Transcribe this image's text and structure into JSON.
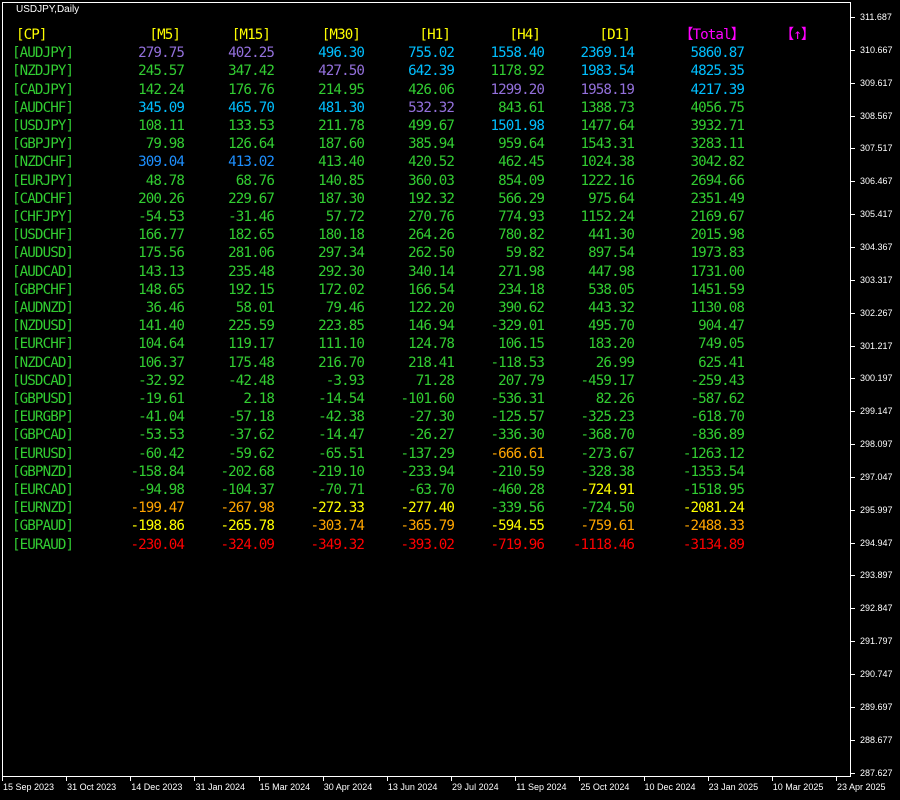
{
  "window": {
    "title": "USDJPY,Daily"
  },
  "colors": {
    "frame": "#ffffff",
    "background": "#000000",
    "axis_text": "#ffffff",
    "header": "#ffff00",
    "header_accent": "#ff00ff",
    "symbol": "#32cd32",
    "purple": "#9370db",
    "blue": "#00bfff",
    "dodger": "#1e90ff",
    "green": "#32cd32",
    "lime": "#7fff00",
    "orange": "#ffa500",
    "yellow": "#ffff00",
    "red": "#ff0000"
  },
  "table": {
    "headers": [
      {
        "label": "[CP]",
        "color": "yellow"
      },
      {
        "label": "[M5]",
        "color": "yellow"
      },
      {
        "label": "[M15]",
        "color": "yellow"
      },
      {
        "label": "[M30]",
        "color": "yellow"
      },
      {
        "label": "[H1]",
        "color": "yellow"
      },
      {
        "label": "[H4]",
        "color": "yellow"
      },
      {
        "label": "[D1]",
        "color": "yellow"
      },
      {
        "label": "【Total】",
        "color": "magenta"
      },
      {
        "label": "【↑】",
        "color": "magenta"
      }
    ],
    "rows": [
      {
        "sym": "[AUDJPY]",
        "v": [
          "279.75",
          "402.25",
          "496.30",
          "755.02",
          "1558.40",
          "2369.14",
          "5860.87"
        ],
        "c": [
          "purple",
          "purple",
          "blue",
          "blue",
          "blue",
          "blue",
          "blue"
        ]
      },
      {
        "sym": "[NZDJPY]",
        "v": [
          "245.57",
          "347.42",
          "427.50",
          "642.39",
          "1178.92",
          "1983.54",
          "4825.35"
        ],
        "c": [
          "green",
          "green",
          "purple",
          "blue",
          "green",
          "blue",
          "blue"
        ]
      },
      {
        "sym": "[CADJPY]",
        "v": [
          "142.24",
          "176.76",
          "214.95",
          "426.06",
          "1299.20",
          "1958.19",
          "4217.39"
        ],
        "c": [
          "green",
          "green",
          "green",
          "green",
          "purple",
          "purple",
          "blue"
        ]
      },
      {
        "sym": "[AUDCHF]",
        "v": [
          "345.09",
          "465.70",
          "481.30",
          "532.32",
          "843.61",
          "1388.73",
          "4056.75"
        ],
        "c": [
          "blue",
          "blue",
          "blue",
          "purple",
          "green",
          "green",
          "green"
        ]
      },
      {
        "sym": "[USDJPY]",
        "v": [
          "108.11",
          "133.53",
          "211.78",
          "499.67",
          "1501.98",
          "1477.64",
          "3932.71"
        ],
        "c": [
          "green",
          "green",
          "green",
          "green",
          "blue",
          "green",
          "green"
        ]
      },
      {
        "sym": "[GBPJPY]",
        "v": [
          "79.98",
          "126.64",
          "187.60",
          "385.94",
          "959.64",
          "1543.31",
          "3283.11"
        ],
        "c": [
          "green",
          "green",
          "green",
          "green",
          "green",
          "green",
          "green"
        ]
      },
      {
        "sym": "[NZDCHF]",
        "v": [
          "309.04",
          "413.02",
          "413.40",
          "420.52",
          "462.45",
          "1024.38",
          "3042.82"
        ],
        "c": [
          "dodger",
          "dodger",
          "green",
          "green",
          "green",
          "green",
          "green"
        ]
      },
      {
        "sym": "[EURJPY]",
        "v": [
          "48.78",
          "68.76",
          "140.85",
          "360.03",
          "854.09",
          "1222.16",
          "2694.66"
        ],
        "c": [
          "green",
          "green",
          "green",
          "green",
          "green",
          "green",
          "green"
        ]
      },
      {
        "sym": "[CADCHF]",
        "v": [
          "200.26",
          "229.67",
          "187.30",
          "192.32",
          "566.29",
          "975.64",
          "2351.49"
        ],
        "c": [
          "green",
          "green",
          "green",
          "green",
          "green",
          "green",
          "green"
        ]
      },
      {
        "sym": "[CHFJPY]",
        "v": [
          "-54.53",
          "-31.46",
          "57.72",
          "270.76",
          "774.93",
          "1152.24",
          "2169.67"
        ],
        "c": [
          "green",
          "green",
          "green",
          "green",
          "green",
          "green",
          "green"
        ]
      },
      {
        "sym": "[USDCHF]",
        "v": [
          "166.77",
          "182.65",
          "180.18",
          "264.26",
          "780.82",
          "441.30",
          "2015.98"
        ],
        "c": [
          "green",
          "green",
          "green",
          "green",
          "green",
          "green",
          "green"
        ]
      },
      {
        "sym": "[AUDUSD]",
        "v": [
          "175.56",
          "281.06",
          "297.34",
          "262.50",
          "59.82",
          "897.54",
          "1973.83"
        ],
        "c": [
          "green",
          "green",
          "green",
          "green",
          "green",
          "green",
          "green"
        ]
      },
      {
        "sym": "[AUDCAD]",
        "v": [
          "143.13",
          "235.48",
          "292.30",
          "340.14",
          "271.98",
          "447.98",
          "1731.00"
        ],
        "c": [
          "green",
          "green",
          "green",
          "green",
          "green",
          "green",
          "green"
        ]
      },
      {
        "sym": "[GBPCHF]",
        "v": [
          "148.65",
          "192.15",
          "172.02",
          "166.54",
          "234.18",
          "538.05",
          "1451.59"
        ],
        "c": [
          "green",
          "green",
          "green",
          "green",
          "green",
          "green",
          "green"
        ]
      },
      {
        "sym": "[AUDNZD]",
        "v": [
          "36.46",
          "58.01",
          "79.46",
          "122.20",
          "390.62",
          "443.32",
          "1130.08"
        ],
        "c": [
          "green",
          "green",
          "green",
          "green",
          "green",
          "green",
          "green"
        ]
      },
      {
        "sym": "[NZDUSD]",
        "v": [
          "141.40",
          "225.59",
          "223.85",
          "146.94",
          "-329.01",
          "495.70",
          "904.47"
        ],
        "c": [
          "green",
          "green",
          "green",
          "green",
          "green",
          "green",
          "green"
        ]
      },
      {
        "sym": "[EURCHF]",
        "v": [
          "104.64",
          "119.17",
          "111.10",
          "124.78",
          "106.15",
          "183.20",
          "749.05"
        ],
        "c": [
          "green",
          "green",
          "green",
          "green",
          "green",
          "green",
          "green"
        ]
      },
      {
        "sym": "[NZDCAD]",
        "v": [
          "106.37",
          "175.48",
          "216.70",
          "218.41",
          "-118.53",
          "26.99",
          "625.41"
        ],
        "c": [
          "green",
          "green",
          "green",
          "green",
          "green",
          "green",
          "green"
        ]
      },
      {
        "sym": "[USDCAD]",
        "v": [
          "-32.92",
          "-42.48",
          "-3.93",
          "71.28",
          "207.79",
          "-459.17",
          "-259.43"
        ],
        "c": [
          "green",
          "green",
          "green",
          "green",
          "green",
          "green",
          "green"
        ]
      },
      {
        "sym": "[GBPUSD]",
        "v": [
          "-19.61",
          "2.18",
          "-14.54",
          "-101.60",
          "-536.31",
          "82.26",
          "-587.62"
        ],
        "c": [
          "green",
          "green",
          "green",
          "green",
          "green",
          "green",
          "green"
        ]
      },
      {
        "sym": "[EURGBP]",
        "v": [
          "-41.04",
          "-57.18",
          "-42.38",
          "-27.30",
          "-125.57",
          "-325.23",
          "-618.70"
        ],
        "c": [
          "green",
          "green",
          "green",
          "green",
          "green",
          "green",
          "green"
        ]
      },
      {
        "sym": "[GBPCAD]",
        "v": [
          "-53.53",
          "-37.62",
          "-14.47",
          "-26.27",
          "-336.30",
          "-368.70",
          "-836.89"
        ],
        "c": [
          "green",
          "green",
          "green",
          "green",
          "green",
          "green",
          "green"
        ]
      },
      {
        "sym": "[EURUSD]",
        "v": [
          "-60.42",
          "-59.62",
          "-65.51",
          "-137.29",
          "-666.61",
          "-273.67",
          "-1263.12"
        ],
        "c": [
          "green",
          "green",
          "green",
          "green",
          "orange",
          "green",
          "green"
        ]
      },
      {
        "sym": "[GBPNZD]",
        "v": [
          "-158.84",
          "-202.68",
          "-219.10",
          "-233.94",
          "-210.59",
          "-328.38",
          "-1353.54"
        ],
        "c": [
          "green",
          "green",
          "green",
          "green",
          "green",
          "green",
          "green"
        ]
      },
      {
        "sym": "[EURCAD]",
        "v": [
          "-94.98",
          "-104.37",
          "-70.71",
          "-63.70",
          "-460.28",
          "-724.91",
          "-1518.95"
        ],
        "c": [
          "green",
          "green",
          "green",
          "green",
          "green",
          "yellow",
          "green"
        ]
      },
      {
        "sym": "[EURNZD]",
        "v": [
          "-199.47",
          "-267.98",
          "-272.33",
          "-277.40",
          "-339.56",
          "-724.50",
          "-2081.24"
        ],
        "c": [
          "orange",
          "orange",
          "yellow",
          "yellow",
          "green",
          "green",
          "yellow"
        ]
      },
      {
        "sym": "[GBPAUD]",
        "v": [
          "-198.86",
          "-265.78",
          "-303.74",
          "-365.79",
          "-594.55",
          "-759.61",
          "-2488.33"
        ],
        "c": [
          "yellow",
          "yellow",
          "orange",
          "orange",
          "yellow",
          "orange",
          "orange"
        ]
      },
      {
        "sym": "[EURAUD]",
        "v": [
          "-230.04",
          "-324.09",
          "-349.32",
          "-393.02",
          "-719.96",
          "-1118.46",
          "-3134.89"
        ],
        "c": [
          "red",
          "red",
          "red",
          "red",
          "red",
          "red",
          "red"
        ]
      }
    ]
  },
  "price_axis": [
    "311.687",
    "310.667",
    "309.617",
    "308.567",
    "307.517",
    "306.467",
    "305.417",
    "304.367",
    "303.317",
    "302.267",
    "301.217",
    "300.197",
    "299.147",
    "298.097",
    "297.047",
    "295.997",
    "294.947",
    "293.897",
    "292.847",
    "291.797",
    "290.747",
    "289.697",
    "288.677",
    "287.627"
  ],
  "time_axis": [
    "15 Sep 2023",
    "31 Oct 2023",
    "14 Dec 2023",
    "31 Jan 2024",
    "15 Mar 2024",
    "30 Apr 2024",
    "13 Jun 2024",
    "29 Jul 2024",
    "11 Sep 2024",
    "25 Oct 2024",
    "10 Dec 2024",
    "23 Jan 2025",
    "10 Mar 2025",
    "23 Apr 2025"
  ]
}
